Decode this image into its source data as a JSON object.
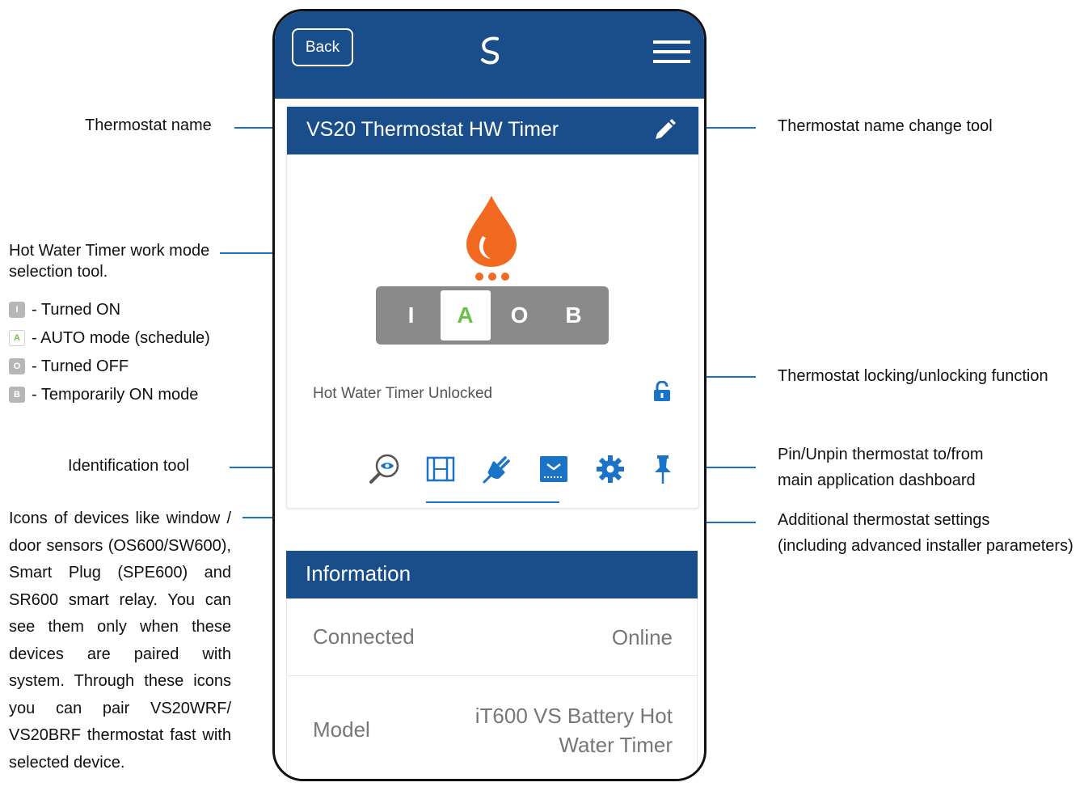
{
  "app": {
    "back_label": "Back",
    "logo_icon": "salus-logo-icon",
    "menu_icon": "hamburger-menu-icon",
    "brand_color": "#1a4e8a"
  },
  "thermostat": {
    "name": "VS20 Thermostat HW Timer",
    "edit_icon": "pencil-icon",
    "status_icon": "water-drop-icon",
    "status_color": "#f26a21",
    "modes": [
      "I",
      "A",
      "O",
      "B"
    ],
    "active_mode": "A",
    "lock_status": "Hot Water Timer Unlocked",
    "lock_icon": "unlocked-padlock-icon",
    "tools": [
      "identify-eye-icon",
      "window-sensor-icon",
      "smart-plug-icon",
      "smart-relay-icon",
      "settings-gear-icon",
      "pin-icon"
    ]
  },
  "information": {
    "title": "Information",
    "rows": [
      {
        "label": "Connected",
        "value": "Online"
      },
      {
        "label": "Model",
        "value": "iT600 VS Battery Hot Water Timer"
      }
    ]
  },
  "annotations": {
    "name": "Thermostat name",
    "name_change": "Thermostat name change tool",
    "mode_tool_line1": "Hot Water Timer work mode",
    "mode_tool_line2": "selection tool.",
    "legend": [
      {
        "chip": "I",
        "text": "- Turned ON"
      },
      {
        "chip": "A",
        "text": "- AUTO mode (schedule)"
      },
      {
        "chip": "O",
        "text": "- Turned OFF"
      },
      {
        "chip": "B",
        "text": "- Temporarily ON mode"
      }
    ],
    "locking": "Thermostat locking/unlocking function",
    "identification": "Identification tool",
    "pin_line1": "Pin/Unpin thermostat to/from",
    "pin_line2": "main application dashboard",
    "settings_line1": "Additional thermostat settings",
    "settings_line2": "(including advanced installer parameters)",
    "devices": "Icons of devices like window / door sensors (OS600/SW600), Smart Plug (SPE600) and SR600 smart relay. You can see them only when these devices are paired with system. Through these icons you can pair VS20WRF/ VS20BRF thermostat fast with selected device."
  }
}
